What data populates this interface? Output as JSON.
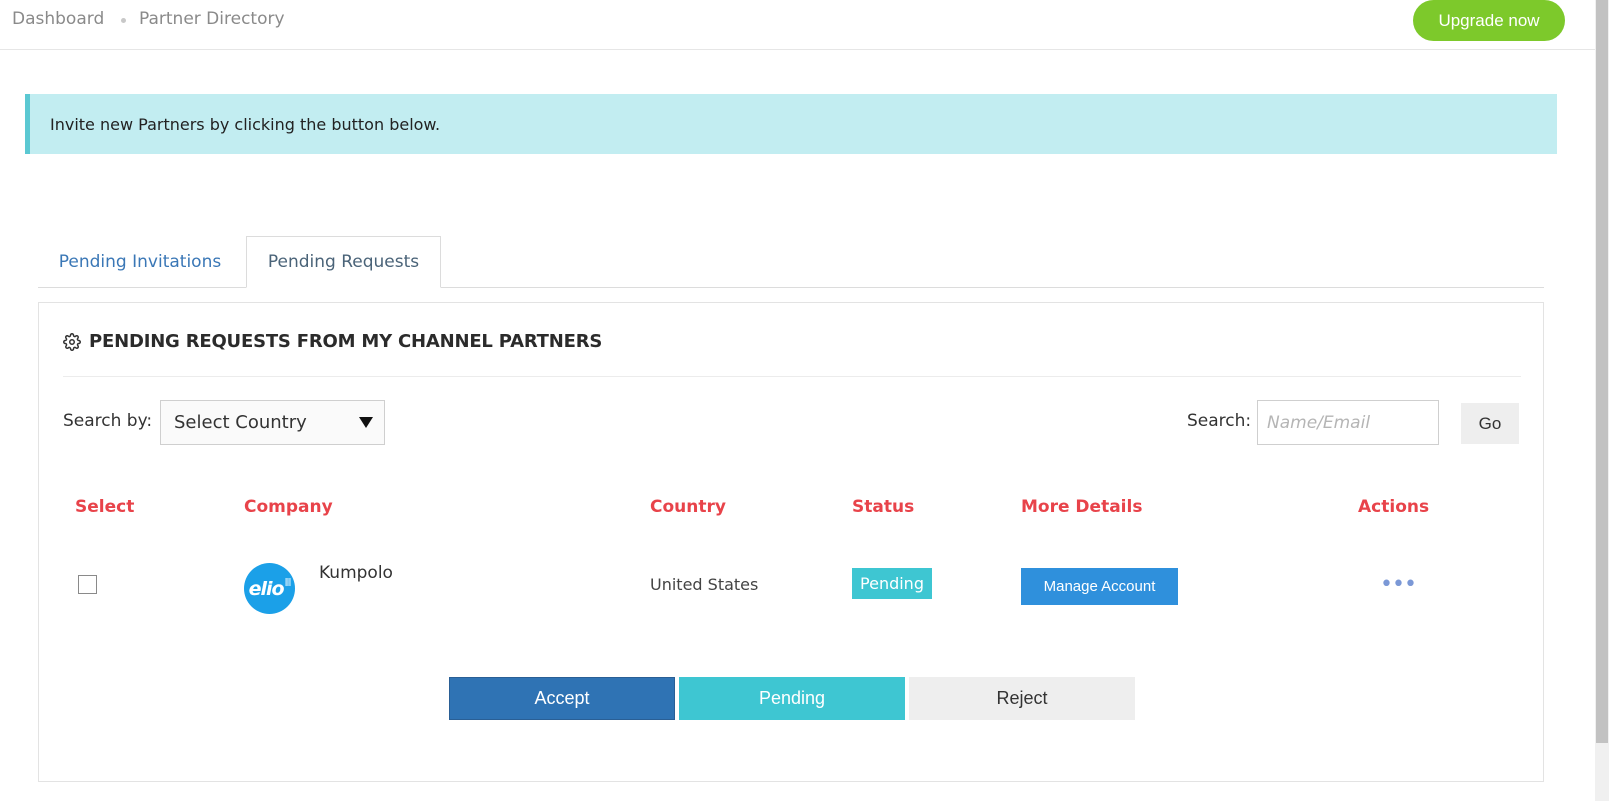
{
  "breadcrumb": {
    "items": [
      "Dashboard",
      "Partner Directory"
    ]
  },
  "header": {
    "upgrade_label": "Upgrade now"
  },
  "alert": {
    "message": "Invite new Partners by clicking the button below."
  },
  "tabs": [
    {
      "label": "Pending Invitations",
      "active": false
    },
    {
      "label": "Pending Requests",
      "active": true
    }
  ],
  "panel": {
    "title": "PENDING REQUESTS FROM MY CHANNEL PARTNERS",
    "title_icon": "gear-icon",
    "search_by_label": "Search by:",
    "country_select_value": "Select Country",
    "search_label": "Search:",
    "search_placeholder": "Name/Email",
    "go_label": "Go"
  },
  "table": {
    "headers": [
      "Select",
      "Company",
      "Country",
      "Status",
      "More Details",
      "Actions"
    ],
    "rows": [
      {
        "selected": false,
        "logo_text": "elio",
        "company": "Kumpolo",
        "country": "United States",
        "status": "Pending",
        "details_label": "Manage Account",
        "actions_label": "•••"
      }
    ]
  },
  "bulk_actions": {
    "accept": "Accept",
    "pending": "Pending",
    "reject": "Reject"
  },
  "colors": {
    "upgrade": "#7dc92b",
    "alert_bg": "#c2edf1",
    "header_text": "#e8434a",
    "status_badge": "#3ec6d2",
    "manage_button": "#2f90dc",
    "accept_button": "#2f73b4",
    "tab_link": "#3a77b6"
  }
}
